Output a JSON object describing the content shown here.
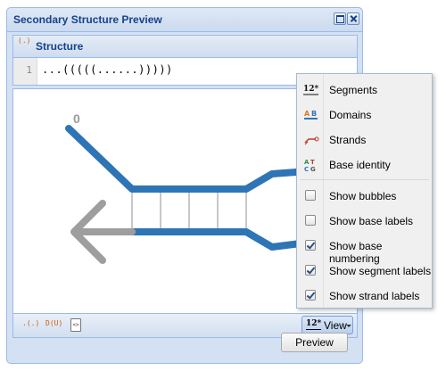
{
  "window": {
    "title": "Secondary Structure Preview"
  },
  "structure": {
    "title": "Structure",
    "icon": "(.)",
    "line_number": "1",
    "code": "...(((((......)))))"
  },
  "canvas": {
    "start_label": "0",
    "strand_color": "#2e75b6",
    "arrow_color": "#9e9e9e",
    "pair_color": "#c8c8c8"
  },
  "toolbar": {
    "icon_dotparen": ".(.)",
    "icon_du": "D(U)",
    "icon_doc": "<>",
    "view_icon": "12*",
    "view_label": "View"
  },
  "menu": {
    "items": [
      {
        "label": "Segments",
        "icon": "segments-icon"
      },
      {
        "label": "Domains",
        "icon": "domains-icon"
      },
      {
        "label": "Strands",
        "icon": "strands-icon"
      },
      {
        "label": "Base identity",
        "icon": "base-identity-icon"
      }
    ],
    "checks": [
      {
        "label": "Show bubbles",
        "checked": false
      },
      {
        "label": "Show base labels",
        "checked": false
      },
      {
        "label": "Show base numbering",
        "checked": true
      },
      {
        "label": "Show segment labels",
        "checked": true
      },
      {
        "label": "Show strand labels",
        "checked": true
      }
    ]
  },
  "preview_button": "Preview"
}
